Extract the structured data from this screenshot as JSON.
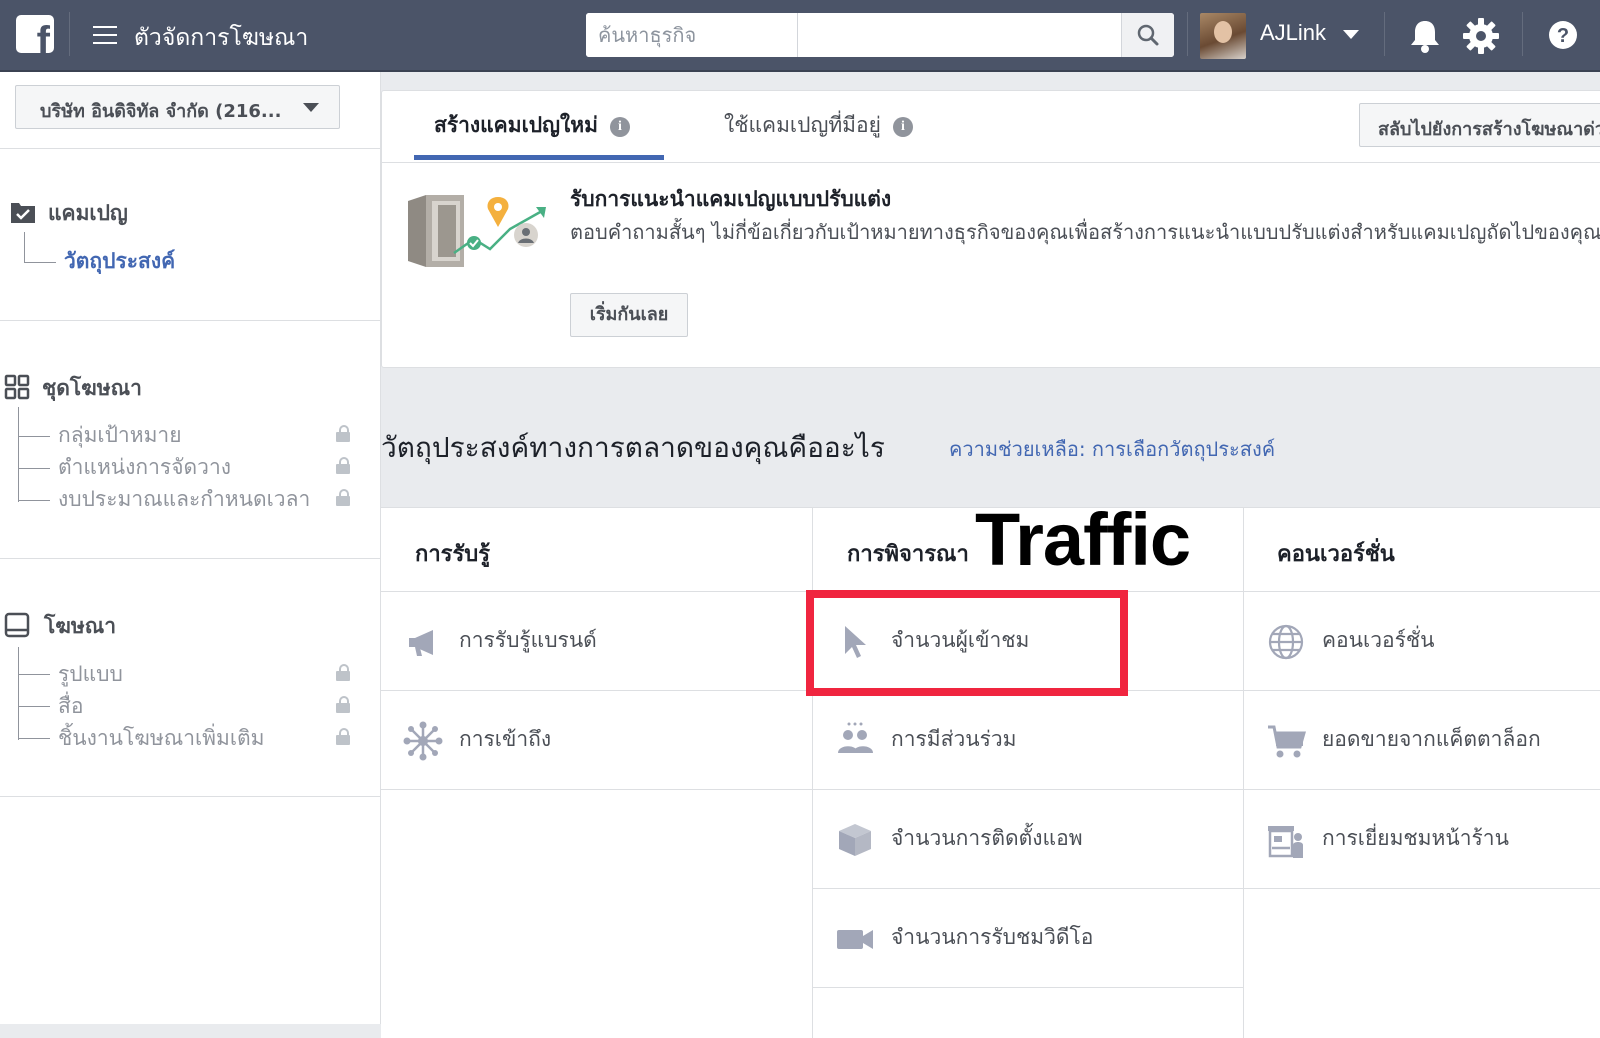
{
  "topbar": {
    "logo_letter": "f",
    "title": "ตัวจัดการโฆษณา",
    "search_placeholder": "ค้นหาธุรกิจ",
    "user_name": "AJLink",
    "icons": [
      "hamburger-icon",
      "search-icon",
      "bell-icon",
      "gear-icon",
      "help-icon"
    ]
  },
  "sidebar": {
    "account": "บริษัท อินดิจิทัล จำกัด (216...",
    "campaign": {
      "title": "แคมเปญ",
      "items": [
        {
          "label": "วัตถุประสงค์",
          "active": true
        }
      ]
    },
    "adset": {
      "title": "ชุดโฆษณา",
      "items": [
        {
          "label": "กลุ่มเป้าหมาย",
          "locked": true
        },
        {
          "label": "ตำแหน่งการจัดวาง",
          "locked": true
        },
        {
          "label": "งบประมาณและกำหนดเวลา",
          "locked": true
        }
      ]
    },
    "ad": {
      "title": "โฆษณา",
      "items": [
        {
          "label": "รูปแบบ",
          "locked": true
        },
        {
          "label": "สื่อ",
          "locked": true
        },
        {
          "label": "ชิ้นงานโฆษณาเพิ่มเติม",
          "locked": true
        }
      ]
    }
  },
  "main": {
    "tabs": [
      {
        "label": "สร้างแคมเปญใหม่",
        "active": true
      },
      {
        "label": "ใช้แคมเปญที่มีอยู่",
        "active": false
      }
    ],
    "info_glyph": "i",
    "switch_button": "สลับไปยังการสร้างโฆษณาด่วน",
    "recommendation": {
      "title": "รับการแนะนำแคมเปญแบบปรับแต่ง",
      "description": "ตอบคำถามสั้นๆ ไม่กี่ข้อเกี่ยวกับเป้าหมายทางธุรกิจของคุณเพื่อสร้างการแนะนำแบบปรับแต่งสำหรับแคมเปญถัดไปของคุณ",
      "button": "เริ่มกันเลย"
    },
    "objective_heading": "วัตถุประสงค์ทางการตลาดของคุณคืออะไร",
    "help_link": "ความช่วยเหลือ: การเลือกวัตถุประสงค์",
    "columns": [
      {
        "title": "การรับรู้",
        "items": [
          {
            "label": "การรับรู้แบรนด์",
            "icon": "megaphone-icon"
          },
          {
            "label": "การเข้าถึง",
            "icon": "reach-icon"
          }
        ]
      },
      {
        "title": "การพิจารณา",
        "items": [
          {
            "label": "จำนวนผู้เข้าชม",
            "icon": "cursor-icon",
            "highlighted": true
          },
          {
            "label": "การมีส่วนร่วม",
            "icon": "people-icon"
          },
          {
            "label": "จำนวนการติดตั้งแอพ",
            "icon": "box-icon"
          },
          {
            "label": "จำนวนการรับชมวิดีโอ",
            "icon": "video-camera-icon"
          }
        ]
      },
      {
        "title": "คอนเวอร์ชั่น",
        "items": [
          {
            "label": "คอนเวอร์ชั่น",
            "icon": "globe-icon"
          },
          {
            "label": "ยอดขายจากแค็ตตาล็อก",
            "icon": "cart-icon"
          },
          {
            "label": "การเยี่ยมชมหน้าร้าน",
            "icon": "store-icon"
          }
        ]
      }
    ]
  },
  "overlay": {
    "text": "Traffic",
    "highlight_color": "#f0253f"
  },
  "colors": {
    "topbar": "#4b5468",
    "accent": "#4267b2",
    "muted": "#90949c"
  }
}
